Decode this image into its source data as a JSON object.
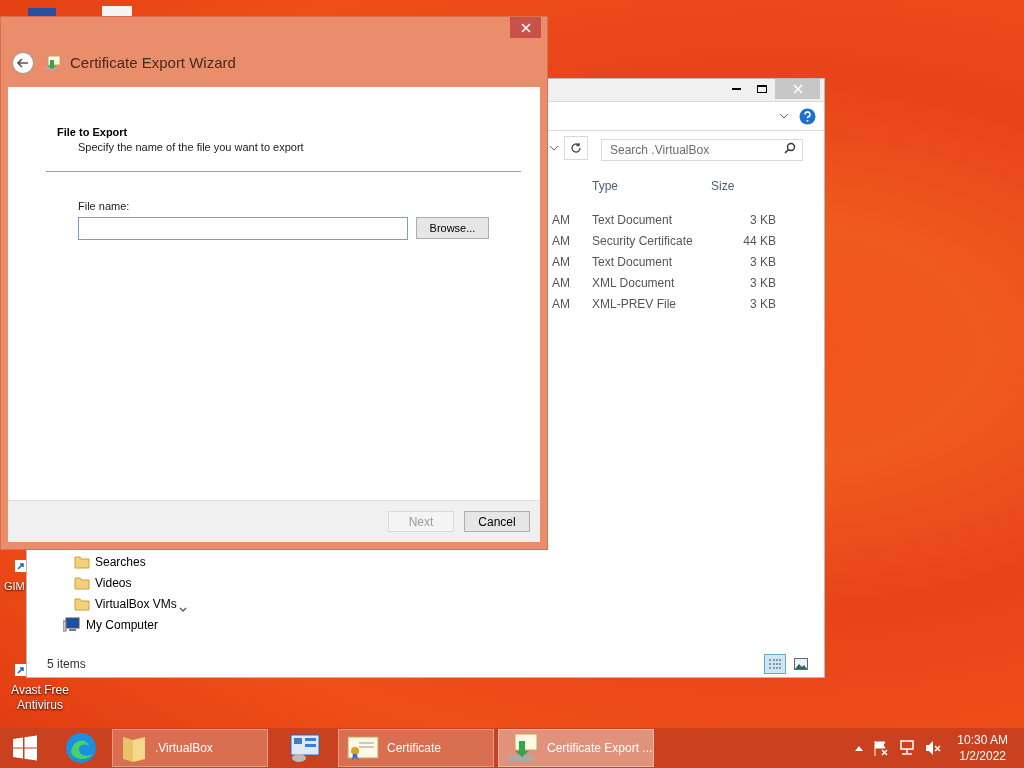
{
  "desktop_icons": [
    {
      "label": "GIM"
    },
    {
      "label": "Avast Free Antivirus"
    }
  ],
  "explorer": {
    "search": {
      "placeholder": "Search .VirtualBox"
    },
    "columns": [
      "Type",
      "Size"
    ],
    "rows": [
      {
        "column_1": "AM",
        "type": "Text Document",
        "size": "3 KB"
      },
      {
        "column_1": "AM",
        "type": "Security Certificate",
        "size": "44 KB"
      },
      {
        "column_1": "AM",
        "type": "Text Document",
        "size": "3 KB"
      },
      {
        "column_1": "AM",
        "type": "XML Document",
        "size": "3 KB"
      },
      {
        "column_1": "AM",
        "type": "XML-PREV File",
        "size": "3 KB"
      }
    ],
    "nav_items": [
      {
        "label": "Searches",
        "kind": "folder"
      },
      {
        "label": "Videos",
        "kind": "folder"
      },
      {
        "label": "VirtualBox VMs",
        "kind": "folder"
      },
      {
        "label": "My Computer",
        "kind": "computer"
      }
    ],
    "status": "5 items",
    "views": [
      {
        "kind": "details",
        "selected": true
      },
      {
        "kind": "thumbnails",
        "selected": false
      }
    ]
  },
  "wizard": {
    "title": "Certificate Export Wizard",
    "heading": "File to Export",
    "subheading": "Specify the name of the file you want to export",
    "field_label": "File name:",
    "browse": "Browse...",
    "buttons": [
      {
        "label": "Next",
        "disabled": true
      },
      {
        "label": "Cancel",
        "disabled": false
      }
    ]
  },
  "taskbar": {
    "items": [
      {
        "kind": "start"
      },
      {
        "kind": "edge"
      },
      {
        "kind": "folder",
        "label": ".VirtualBox",
        "selected": false
      },
      {
        "kind": "control-panel"
      },
      {
        "kind": "certificate",
        "label": "Certificate",
        "selected": false
      },
      {
        "kind": "wizard",
        "label": "Certificate Export ...",
        "selected": true
      }
    ],
    "time": "10:30 AM",
    "date": "1/2/2022"
  }
}
